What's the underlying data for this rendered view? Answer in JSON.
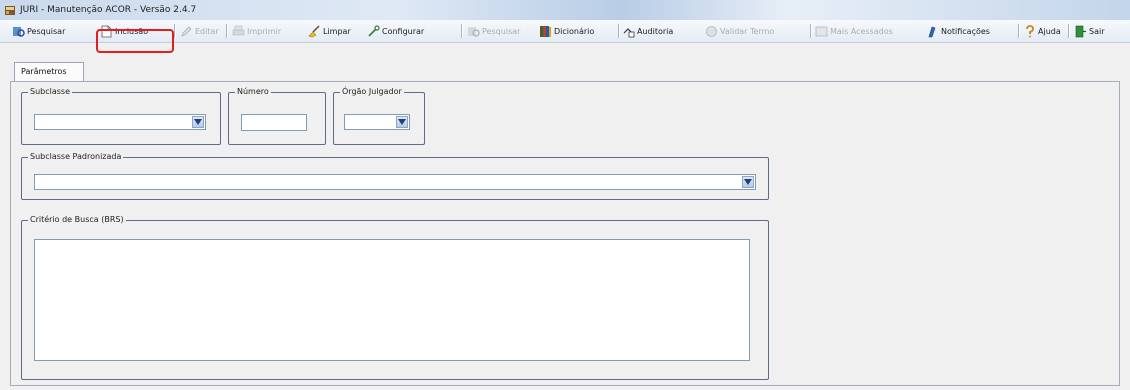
{
  "window": {
    "title": "JURI - Manutenção ACOR - Versão 2.4.7"
  },
  "toolbar": {
    "items": [
      {
        "label": "Pesquisar",
        "icon": "search-icon",
        "enabled": true
      },
      {
        "label": "Inclusão",
        "icon": "new-document-icon",
        "enabled": true
      },
      {
        "label": "Editar",
        "icon": "edit-icon",
        "enabled": false
      },
      {
        "label": "Imprimir",
        "icon": "print-icon",
        "enabled": false
      },
      {
        "label": "Limpar",
        "icon": "clear-icon",
        "enabled": true
      },
      {
        "label": "Configurar",
        "icon": "configure-icon",
        "enabled": true
      },
      {
        "label": "Pesquisar",
        "icon": "search-icon",
        "enabled": false
      },
      {
        "label": "Dicionário",
        "icon": "dictionary-icon",
        "enabled": true
      },
      {
        "label": "Auditoria",
        "icon": "audit-icon",
        "enabled": true
      },
      {
        "label": "Validar Termo",
        "icon": "validate-icon",
        "enabled": false
      },
      {
        "label": "Mais Acessados",
        "icon": "list-icon",
        "enabled": false
      },
      {
        "label": "Notificações",
        "icon": "notification-icon",
        "enabled": true
      },
      {
        "label": "Ajuda",
        "icon": "help-icon",
        "enabled": true
      },
      {
        "label": "Sair",
        "icon": "exit-icon",
        "enabled": true
      }
    ]
  },
  "tabs": [
    {
      "label": "Parâmetros"
    }
  ],
  "form": {
    "subclasse": {
      "legend": "Subclasse",
      "value": ""
    },
    "numero": {
      "legend": "Número",
      "value": ""
    },
    "orgao_julgador": {
      "legend": "Órgão Julgador",
      "value": ""
    },
    "subclasse_padronizada": {
      "legend": "Subclasse Padronizada",
      "value": ""
    },
    "criterio_busca": {
      "legend": "Critério de Busca (BRS)",
      "value": ""
    }
  },
  "colors": {
    "highlight": "#e02020",
    "group_border": "#5f6a8d"
  }
}
